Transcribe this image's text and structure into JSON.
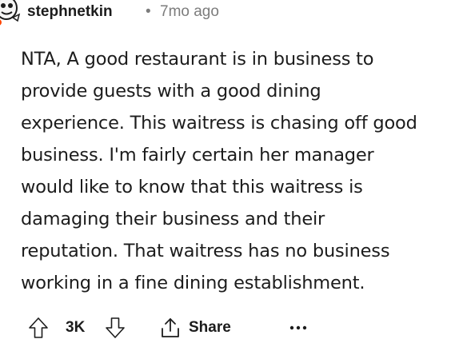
{
  "comment": {
    "username": "stephnetkin",
    "separator": "•",
    "age": "7mo ago",
    "body_lines": [
      "NTA, A good restaurant is in business to",
      "provide guests with a good dining",
      "experience. This waitress is chasing off good",
      "business. I'm fairly certain her manager",
      "would like to know that this waitress is",
      "damaging their business and their",
      "reputation. That waitress has no business",
      "working in a fine dining establishment."
    ]
  },
  "actions": {
    "upvote_icon": "upvote-arrow-icon",
    "score": "3K",
    "downvote_icon": "downvote-arrow-icon",
    "share_icon": "share-icon",
    "share_label": "Share",
    "more_icon": "more-options-icon"
  },
  "colors": {
    "text": "#1c1c1c",
    "meta": "#7c7c7c",
    "avatar_accent": "#ff4500"
  }
}
